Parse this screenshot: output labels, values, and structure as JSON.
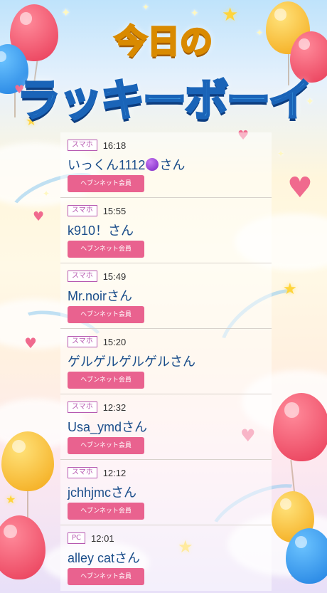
{
  "banner": {
    "title_line1": "今日の",
    "title_line2": "ラッキーボーイ"
  },
  "entries": [
    {
      "device": "スマホ",
      "time": "16:18",
      "name_prefix": "いっくん1112",
      "has_emoji": true,
      "name_suffix": "さん",
      "badge": "ヘブンネット会員"
    },
    {
      "device": "スマホ",
      "time": "15:55",
      "name": "k910！さん",
      "badge": "ヘブンネット会員"
    },
    {
      "device": "スマホ",
      "time": "15:49",
      "name": "Mr.noirさん",
      "badge": "ヘブンネット会員"
    },
    {
      "device": "スマホ",
      "time": "15:20",
      "name": "ゲルゲルゲルゲルさん",
      "badge": "ヘブンネット会員"
    },
    {
      "device": "スマホ",
      "time": "12:32",
      "name": "Usa_ymdさん",
      "badge": "ヘブンネット会員"
    },
    {
      "device": "スマホ",
      "time": "12:12",
      "name": "jchhjmcさん",
      "badge": "ヘブンネット会員"
    },
    {
      "device": "PC",
      "time": "12:01",
      "name": "alley catさん",
      "badge": "ヘブンネット会員"
    }
  ],
  "colors": {
    "device_badge": "#b658b0",
    "name_text": "#1a4d8a",
    "member_button": "#e9628f",
    "emoji_dot": "#8a2be2"
  },
  "icons": {
    "emoji": "purple-circle-icon"
  }
}
